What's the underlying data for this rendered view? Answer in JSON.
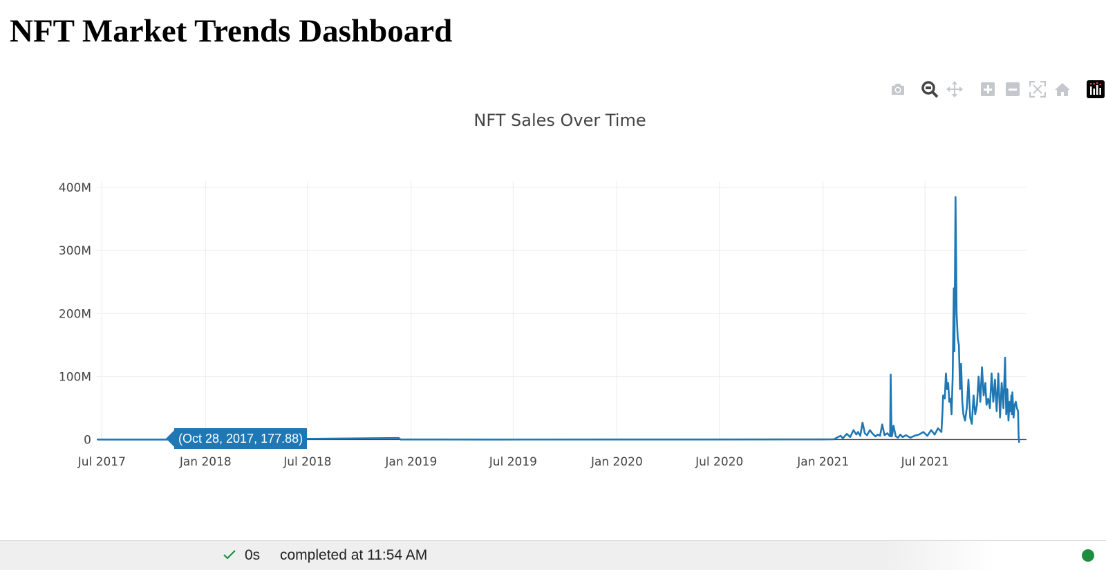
{
  "page": {
    "title": "NFT Market Trends Dashboard"
  },
  "modebar": {
    "icons": [
      "camera-icon",
      "zoom-icon",
      "pan-icon",
      "zoom-in-icon",
      "zoom-out-icon",
      "autoscale-icon",
      "reset-axes-icon",
      "plotly-logo-icon"
    ]
  },
  "chart_data": {
    "type": "line",
    "title": "NFT Sales Over Time",
    "xlabel": "",
    "ylabel": "",
    "x_tick_labels": [
      "Jul 2017",
      "Jan 2018",
      "Jul 2018",
      "Jan 2019",
      "Jul 2019",
      "Jan 2020",
      "Jul 2020",
      "Jan 2021",
      "Jul 2021"
    ],
    "y_tick_labels": [
      "0",
      "100M",
      "200M",
      "300M",
      "400M"
    ],
    "xlim": [
      "2017-06-22",
      "2021-12-28"
    ],
    "ylim": [
      -5000000,
      410000000
    ],
    "grid": true,
    "color": "#1f77b4",
    "series": [
      {
        "x": [
          "2017-06-23",
          "2017-10-28",
          "2018-06-01",
          "2018-12-10",
          "2018-12-13",
          "2019-06-01",
          "2020-06-01",
          "2021-01-01",
          "2021-01-20",
          "2021-02-01",
          "2021-02-05",
          "2021-02-12",
          "2021-02-18",
          "2021-02-24",
          "2021-03-01",
          "2021-03-04",
          "2021-03-08",
          "2021-03-12",
          "2021-03-16",
          "2021-03-20",
          "2021-03-25",
          "2021-03-30",
          "2021-04-04",
          "2021-04-08",
          "2021-04-12",
          "2021-04-16",
          "2021-04-20",
          "2021-04-25",
          "2021-04-30",
          "2021-05-01",
          "2021-05-02",
          "2021-05-03",
          "2021-05-04",
          "2021-05-06",
          "2021-05-10",
          "2021-05-14",
          "2021-05-18",
          "2021-05-22",
          "2021-05-28",
          "2021-06-05",
          "2021-06-12",
          "2021-06-20",
          "2021-06-28",
          "2021-07-05",
          "2021-07-12",
          "2021-07-18",
          "2021-07-24",
          "2021-07-30",
          "2021-08-01",
          "2021-08-02",
          "2021-08-05",
          "2021-08-07",
          "2021-08-09",
          "2021-08-11",
          "2021-08-13",
          "2021-08-15",
          "2021-08-17",
          "2021-08-19",
          "2021-08-21",
          "2021-08-22",
          "2021-08-24",
          "2021-08-26",
          "2021-08-28",
          "2021-08-30",
          "2021-09-01",
          "2021-09-03",
          "2021-09-05",
          "2021-09-07",
          "2021-09-10",
          "2021-09-13",
          "2021-09-16",
          "2021-09-19",
          "2021-09-22",
          "2021-09-25",
          "2021-09-28",
          "2021-10-01",
          "2021-10-04",
          "2021-10-07",
          "2021-10-10",
          "2021-10-13",
          "2021-10-16",
          "2021-10-18",
          "2021-10-21",
          "2021-10-24",
          "2021-10-27",
          "2021-10-30",
          "2021-11-02",
          "2021-11-05",
          "2021-11-08",
          "2021-11-11",
          "2021-11-14",
          "2021-11-17",
          "2021-11-20",
          "2021-11-22",
          "2021-11-24",
          "2021-11-26",
          "2021-11-28",
          "2021-11-29",
          "2021-11-30",
          "2021-12-01",
          "2021-12-02",
          "2021-12-03",
          "2021-12-05",
          "2021-12-07",
          "2021-12-09",
          "2021-12-11",
          "2021-12-13",
          "2021-12-14",
          "2021-12-15"
        ],
        "y": [
          178,
          178,
          1000000,
          2500000,
          200000,
          100000,
          150000,
          300000,
          500000,
          6000000,
          2000000,
          9000000,
          4000000,
          15000000,
          8000000,
          12000000,
          6000000,
          27000000,
          10000000,
          7000000,
          15000000,
          9000000,
          5000000,
          8000000,
          6000000,
          24000000,
          7000000,
          10000000,
          5000000,
          103000000,
          30000000,
          5000000,
          9000000,
          22000000,
          5000000,
          3000000,
          8000000,
          4000000,
          7000000,
          3000000,
          6000000,
          8000000,
          12000000,
          6000000,
          15000000,
          8000000,
          18000000,
          12000000,
          45000000,
          70000000,
          65000000,
          105000000,
          80000000,
          90000000,
          60000000,
          65000000,
          40000000,
          100000000,
          240000000,
          140000000,
          385000000,
          200000000,
          160000000,
          150000000,
          80000000,
          120000000,
          60000000,
          40000000,
          30000000,
          50000000,
          95000000,
          35000000,
          25000000,
          70000000,
          40000000,
          55000000,
          100000000,
          60000000,
          115000000,
          70000000,
          90000000,
          55000000,
          65000000,
          50000000,
          105000000,
          60000000,
          95000000,
          45000000,
          105000000,
          35000000,
          90000000,
          50000000,
          130000000,
          40000000,
          80000000,
          30000000,
          60000000,
          50000000,
          45000000,
          70000000,
          40000000,
          75000000,
          35000000,
          55000000,
          60000000,
          50000000,
          45000000,
          5000000,
          -5000000
        ]
      }
    ],
    "hover_point": {
      "x": "Oct 28, 2017",
      "y": 177.88,
      "label": "(Oct 28, 2017, 177.88)"
    }
  },
  "status": {
    "check_icon": "check-icon",
    "duration": "0s",
    "text": "completed at 11:54 AM",
    "dot_color": "#1e8e3e"
  }
}
